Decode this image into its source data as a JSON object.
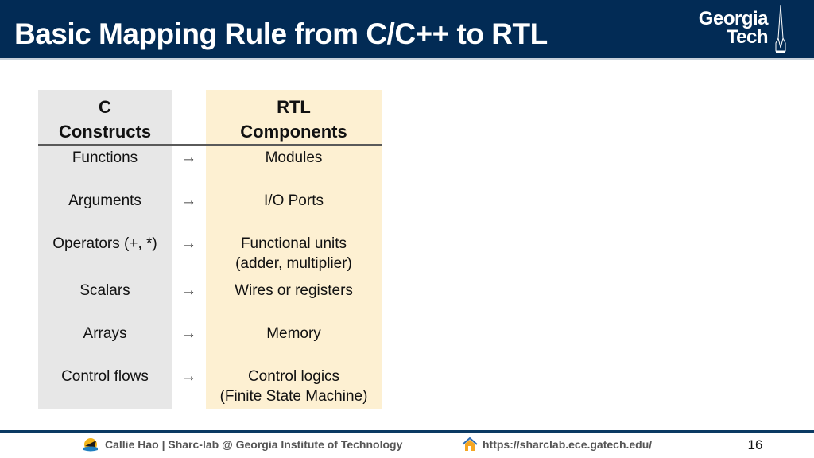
{
  "slide": {
    "title": "Basic Mapping Rule from C/C++ to RTL",
    "logo": {
      "line1": "Georgia",
      "line2": "Tech"
    },
    "table": {
      "headers": {
        "c": [
          "C",
          "Constructs"
        ],
        "rtl": [
          "RTL",
          "Components"
        ]
      },
      "arrow": "→",
      "rows": [
        {
          "c": "Functions",
          "rtl": [
            "Modules"
          ]
        },
        {
          "c": "Arguments",
          "rtl": [
            "I/O Ports"
          ]
        },
        {
          "c": "Operators (+, *)",
          "rtl": [
            "Functional units",
            "(adder, multiplier)"
          ]
        },
        {
          "c": "Scalars",
          "rtl": [
            "Wires or registers"
          ]
        },
        {
          "c": "Arrays",
          "rtl": [
            "Memory"
          ]
        },
        {
          "c": "Control flows",
          "rtl": [
            "Control logics",
            "(Finite State Machine)"
          ]
        }
      ]
    },
    "footer": {
      "author": "Callie Hao | Sharc-lab @ Georgia Institute of Technology",
      "url": "https://sharclab.ece.gatech.edu/",
      "page_number": "16"
    },
    "colors": {
      "header_bg": "#022b55",
      "c_column_bg": "#e7e7e7",
      "rtl_column_bg": "#fdf0d2"
    }
  }
}
